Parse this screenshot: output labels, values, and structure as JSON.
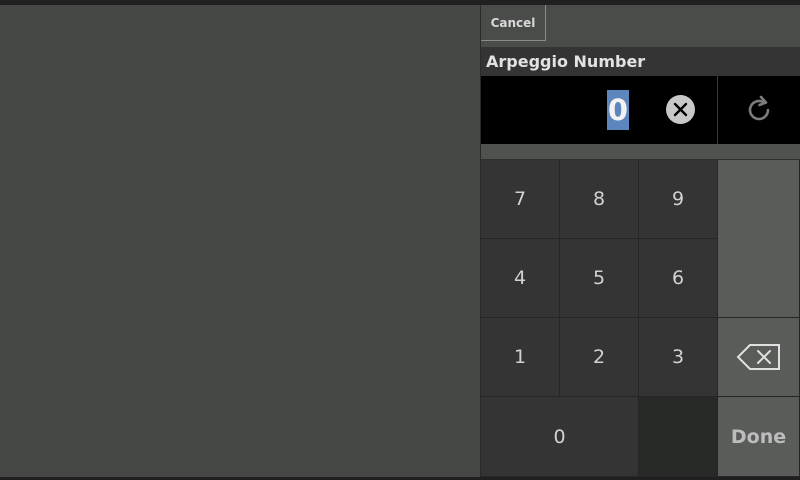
{
  "panel": {
    "cancel_label": "Cancel",
    "title": "Arpeggio Number",
    "value": "0"
  },
  "keypad": {
    "k7": "7",
    "k8": "8",
    "k9": "9",
    "k4": "4",
    "k5": "5",
    "k6": "6",
    "k1": "1",
    "k2": "2",
    "k3": "3",
    "k0": "0",
    "done_label": "Done"
  },
  "icons": {
    "clear": "clear-circle-x-icon",
    "reset": "refresh-icon",
    "backspace": "backspace-icon"
  },
  "colors": {
    "background": "#454745",
    "display": "#000000",
    "selection": "#5c86bd",
    "key": "#333433",
    "side_key": "#5a5c5a"
  }
}
